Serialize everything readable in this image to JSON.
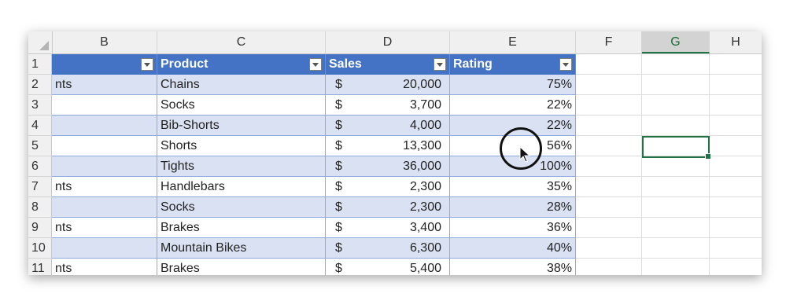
{
  "columns": [
    "B",
    "C",
    "D",
    "E",
    "F",
    "G",
    "H"
  ],
  "selected_column": "G",
  "table_headers": {
    "product": "Product",
    "sales": "Sales",
    "rating": "Rating"
  },
  "rows": [
    {
      "num": "1"
    },
    {
      "num": "2",
      "b": "nts",
      "product": "Chains",
      "cur": "$",
      "sales": "20,000",
      "rating": "75%"
    },
    {
      "num": "3",
      "b": "",
      "product": "Socks",
      "cur": "$",
      "sales": "3,700",
      "rating": "22%"
    },
    {
      "num": "4",
      "b": "",
      "product": "Bib-Shorts",
      "cur": "$",
      "sales": "4,000",
      "rating": "22%"
    },
    {
      "num": "5",
      "b": "",
      "product": "Shorts",
      "cur": "$",
      "sales": "13,300",
      "rating": "56%"
    },
    {
      "num": "6",
      "b": "",
      "product": "Tights",
      "cur": "$",
      "sales": "36,000",
      "rating": "100%"
    },
    {
      "num": "7",
      "b": "nts",
      "product": "Handlebars",
      "cur": "$",
      "sales": "2,300",
      "rating": "35%"
    },
    {
      "num": "8",
      "b": "",
      "product": "Socks",
      "cur": "$",
      "sales": "2,300",
      "rating": "28%"
    },
    {
      "num": "9",
      "b": "nts",
      "product": "Brakes",
      "cur": "$",
      "sales": "3,400",
      "rating": "36%"
    },
    {
      "num": "10",
      "b": "",
      "product": "Mountain Bikes",
      "cur": "$",
      "sales": "6,300",
      "rating": "40%"
    },
    {
      "num": "11",
      "b": "nts",
      "product": "Brakes",
      "cur": "$",
      "sales": "5,400",
      "rating": "38%"
    }
  ],
  "colors": {
    "header": "#4472c4",
    "band": "#d9e1f2",
    "selection": "#217346"
  }
}
